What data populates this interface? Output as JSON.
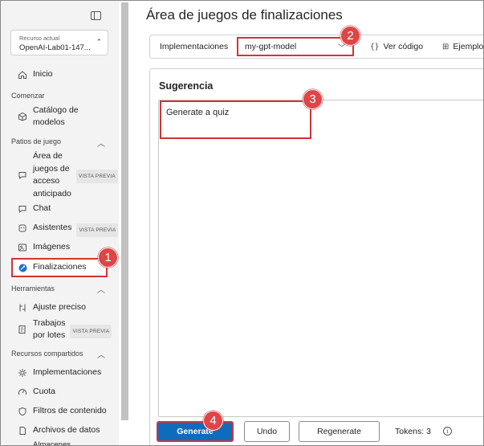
{
  "sidebar": {
    "resource_caption": "Recurso actual",
    "resource_name": "OpenAI-Lab01-147...",
    "home": "Inicio",
    "section_start": "Comenzar",
    "model_catalog": "Catálogo de modelos",
    "section_playgrounds": "Patios de juego",
    "early_access_line1": "Área de",
    "early_access_line2": "juegos de",
    "early_access_line3": "acceso",
    "early_access_line4": "anticipado",
    "preview_badge": "VISTA PREVIA",
    "chat": "Chat",
    "assistants": "Asistentes",
    "images": "Imágenes",
    "completions": "Finalizaciones",
    "section_tools": "Herramientas",
    "fine_tuning": "Ajuste preciso",
    "batch_line1": "Trabajos",
    "batch_line2": "por lotes",
    "section_shared": "Recursos compartidos",
    "deployments": "Implementaciones",
    "quota": "Cuota",
    "content_filters": "Filtros de contenido",
    "data_files": "Archivos de datos",
    "storage_partial": "Almacenes"
  },
  "main": {
    "title": "Área de juegos de finalizaciones",
    "deployments_label": "Implementaciones",
    "deployment_value": "my-gpt-model",
    "view_code": "Ver código",
    "examples": "Ejemplo",
    "suggestion_label": "Sugerencia",
    "prompt_text": "Generate a quiz",
    "generate": "Generate",
    "undo": "Undo",
    "regenerate": "Regenerate",
    "tokens": "Tokens: 3"
  },
  "steps": [
    "1",
    "2",
    "3",
    "4"
  ],
  "colors": {
    "accent": "#0f6cbd",
    "highlight": "#d13438",
    "marker": "#e04447"
  }
}
